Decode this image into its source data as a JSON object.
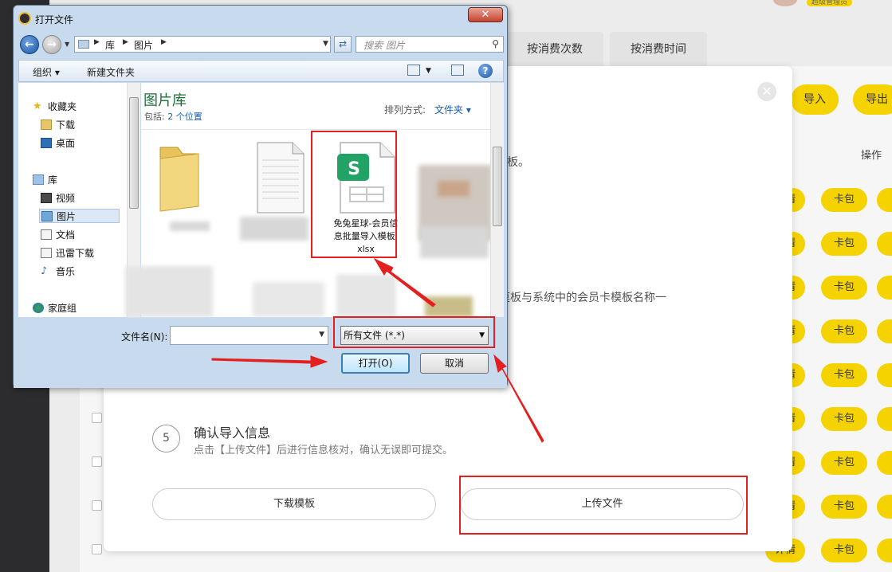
{
  "background": {
    "admin_badge": "超级管理员",
    "tabs": [
      "按消费次数",
      "按消费时间"
    ],
    "buttons": {
      "import": "导入",
      "export": "导出"
    },
    "table_header_op": "操作",
    "row_buttons": [
      "详情",
      "卡包"
    ],
    "yellow": "#f5d300"
  },
  "modal": {
    "text_partial_a": "板。",
    "text_partial_b": "莫板与系统中的会员卡模板名称一",
    "step5": {
      "num": "5",
      "title": "确认导入信息",
      "desc": "点击【上传文件】后进行信息核对，确认无误即可提交。"
    },
    "download_btn": "下载模板",
    "upload_btn": "上传文件",
    "close_icon": "close-icon"
  },
  "dialog": {
    "title": "打开文件",
    "close": "✕",
    "address": [
      "库",
      "图片"
    ],
    "search_placeholder": "搜索 图片",
    "toolbar": {
      "organize": "组织 ▾",
      "new_folder": "新建文件夹"
    },
    "nav": [
      {
        "label": "收藏夹",
        "icon": "star-icon"
      },
      {
        "label": "下载",
        "icon": "folder-download-icon"
      },
      {
        "label": "桌面",
        "icon": "desktop-icon"
      },
      {
        "label": "库",
        "icon": "library-icon"
      },
      {
        "label": "视频",
        "icon": "video-icon"
      },
      {
        "label": "图片",
        "icon": "picture-icon"
      },
      {
        "label": "文档",
        "icon": "document-icon"
      },
      {
        "label": "迅雷下载",
        "icon": "thunder-download-icon"
      },
      {
        "label": "音乐",
        "icon": "music-icon"
      },
      {
        "label": "家庭组",
        "icon": "homegroup-icon"
      }
    ],
    "library_title": "图片库",
    "include_label": "包括:",
    "include_link": "2 个位置",
    "sort_label": "排列方式:",
    "sort_value": "文件夹 ▾",
    "file_name_line1": "免兔星球-会员信",
    "file_name_line2": "息批量导入模板.",
    "file_name_line3": "xlsx",
    "file_badge": "S",
    "filename_label": "文件名(N):",
    "filetype_value": "所有文件 (*.*)",
    "open_btn": "打开(O)",
    "cancel_btn": "取消"
  }
}
